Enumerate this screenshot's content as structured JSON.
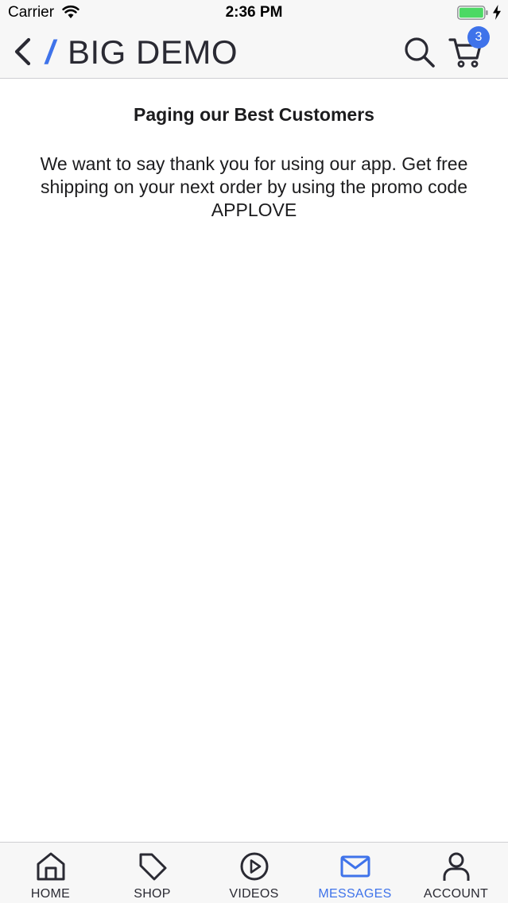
{
  "status_bar": {
    "carrier": "Carrier",
    "time": "2:36 PM"
  },
  "nav": {
    "brand_slash": "/",
    "title": "BIG DEMO",
    "cart_count": "3",
    "back_icon": "chevron-left-icon",
    "search_icon": "search-icon",
    "cart_icon": "cart-icon"
  },
  "message": {
    "title": "Paging our Best Customers",
    "body": "We want to say thank you for using our app. Get free shipping on your next order by using the promo code APPLOVE"
  },
  "tabs": [
    {
      "label": "HOME",
      "icon": "home-icon",
      "active": false
    },
    {
      "label": "SHOP",
      "icon": "tag-icon",
      "active": false
    },
    {
      "label": "VIDEOS",
      "icon": "play-icon",
      "active": false
    },
    {
      "label": "MESSAGES",
      "icon": "mail-icon",
      "active": true
    },
    {
      "label": "ACCOUNT",
      "icon": "user-icon",
      "active": false
    }
  ],
  "colors": {
    "accent": "#3f73ea",
    "battery": "#4cd964",
    "text": "#1c1c1e",
    "bar_background": "#f7f7f7"
  }
}
